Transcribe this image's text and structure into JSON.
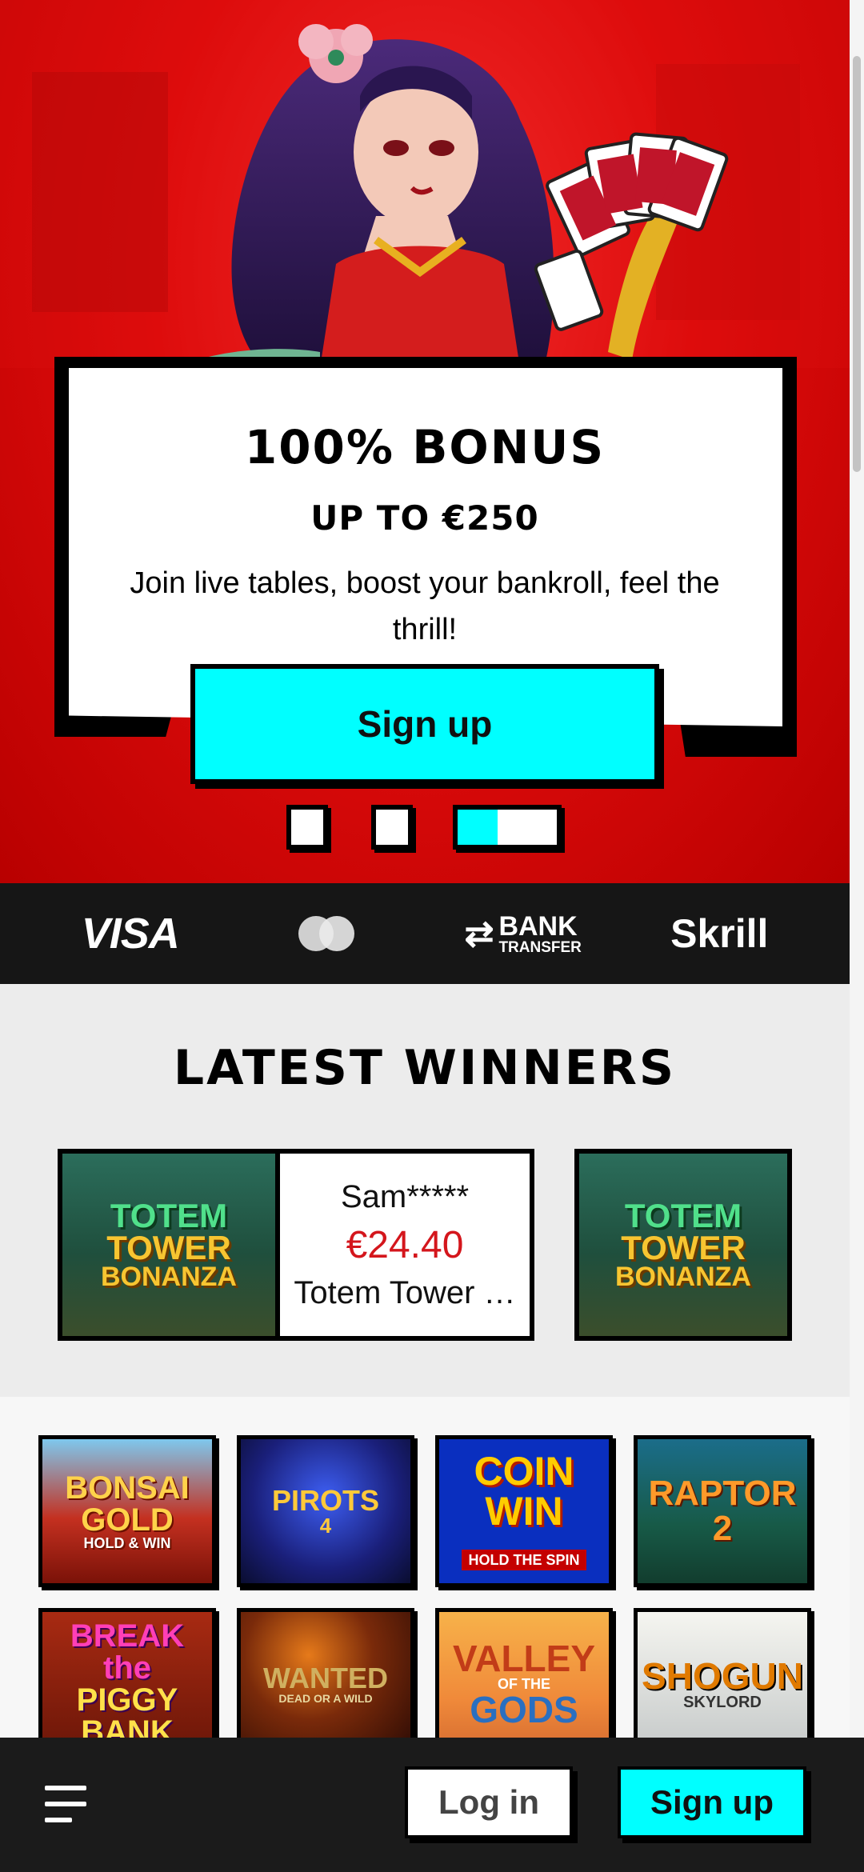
{
  "hero": {
    "title": "100% Bonus",
    "subtitle": "Up to €250",
    "description": "Join live tables, boost your bankroll, feel the thrill!",
    "cta": "Sign up",
    "slides_total": 3,
    "active_slide": 3
  },
  "payments": {
    "visa": "VISA",
    "bank_line1": "BANK",
    "bank_line2": "TRANSFER",
    "skrill": "Skrill",
    "icons": [
      "visa-logo",
      "mastercard-logo",
      "bank-transfer-logo",
      "skrill-logo"
    ]
  },
  "winners": {
    "title": "Latest Winners",
    "items": [
      {
        "name": "Sam*****",
        "amount": "€24.40",
        "game": "Totem Tower …",
        "art_text": [
          "TOTEM",
          "TOWER",
          "BONANZA"
        ]
      },
      {
        "art_text": [
          "TOTEM",
          "TOWER",
          "BONANZA"
        ]
      }
    ]
  },
  "games": [
    {
      "art": [
        "BONSAI",
        "GOLD",
        "HOLD & WIN"
      ]
    },
    {
      "art": [
        "PIROTS",
        "4"
      ]
    },
    {
      "art": [
        "COIN",
        "WIN",
        "HOLD THE SPIN"
      ]
    },
    {
      "art": [
        "RAPTOR 2"
      ]
    },
    {
      "art": [
        "BREAK the",
        "PIGGY BANK"
      ]
    },
    {
      "art": [
        "WANTED",
        "DEAD OR A WILD"
      ]
    },
    {
      "art": [
        "VALLEY",
        "OF THE",
        "GODS"
      ]
    },
    {
      "art": [
        "SHOGUN",
        "SKYLORD"
      ]
    }
  ],
  "bottom_bar": {
    "login": "Log in",
    "signup": "Sign up"
  },
  "colors": {
    "accent": "#00ffff",
    "hero_red": "#e00c0c",
    "amount_red": "#d4161c",
    "dark": "#1b1b1b"
  }
}
